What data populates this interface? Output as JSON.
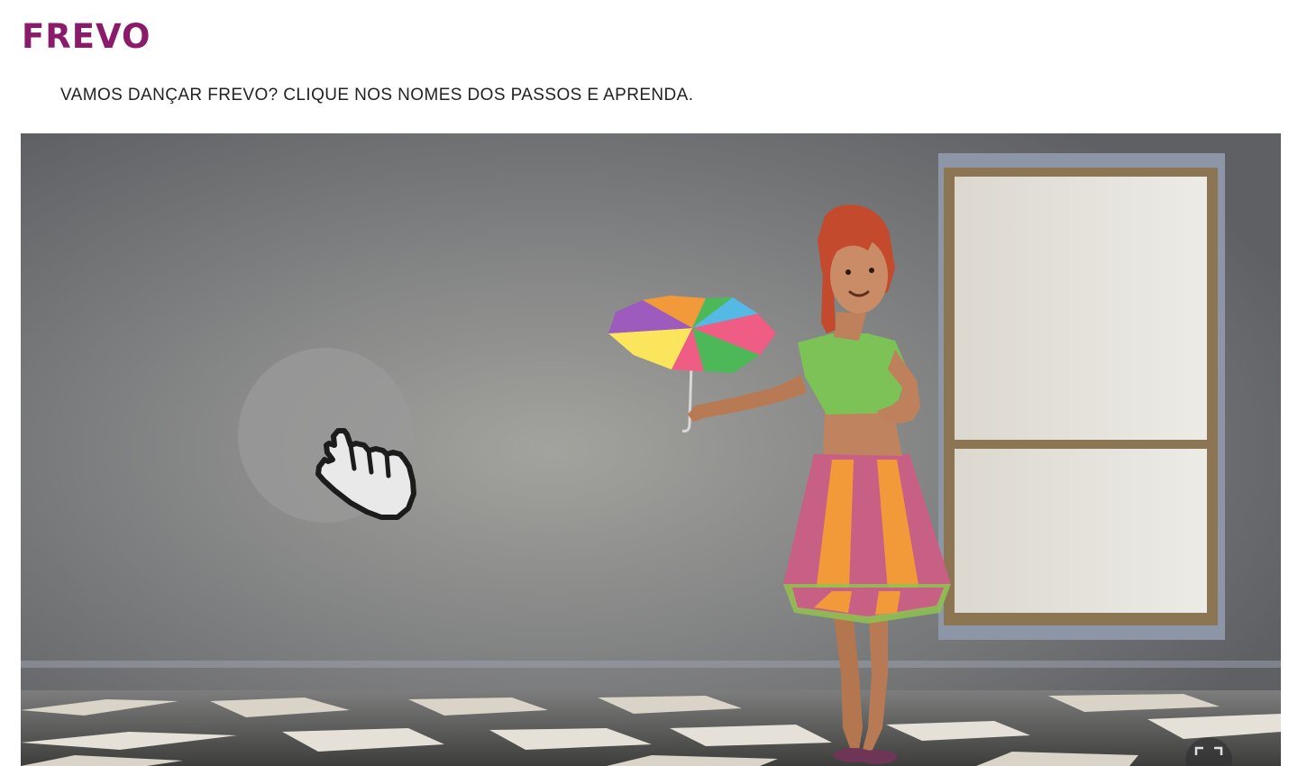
{
  "page": {
    "title": "FREVO",
    "subtitle": "VAMOS DANÇAR FREVO? CLIQUE NOS NOMES DOS PASSOS E APRENDA."
  },
  "video": {
    "scene": "animated-frevo-dancer-with-umbrella",
    "icons": [
      "tap-hand-icon",
      "fullscreen-icon"
    ]
  },
  "colors": {
    "title": "#8a1a6a",
    "text": "#222222",
    "wall": "#76777a"
  }
}
